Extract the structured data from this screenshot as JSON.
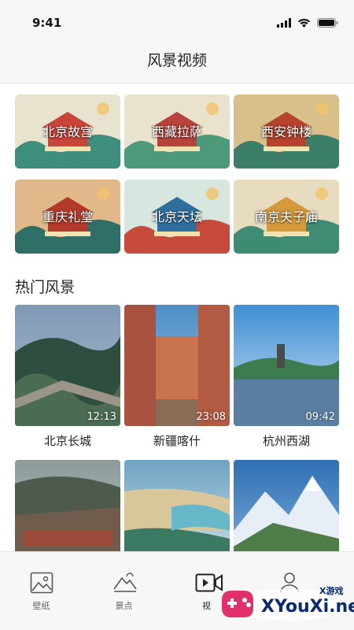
{
  "status_bar": {
    "time": "9:41",
    "icons": [
      "signal-icon",
      "wifi-icon",
      "battery-icon"
    ]
  },
  "nav": {
    "title": "风景视频"
  },
  "categories": [
    {
      "label": "北京故宫",
      "palette": [
        "#e8e3cf",
        "#c9453a",
        "#3e8e7e"
      ]
    },
    {
      "label": "西藏拉萨",
      "palette": [
        "#e9e2cc",
        "#b8423c",
        "#4d9a7a"
      ]
    },
    {
      "label": "西安钟楼",
      "palette": [
        "#d9c08a",
        "#b5432e",
        "#3c7f69"
      ]
    },
    {
      "label": "重庆礼堂",
      "palette": [
        "#e1b88a",
        "#b43a2c",
        "#2f6f67"
      ]
    },
    {
      "label": "北京天坛",
      "palette": [
        "#d7e6df",
        "#2f6f9e",
        "#c64b3a"
      ]
    },
    {
      "label": "南京夫子庙",
      "palette": [
        "#e7dcc0",
        "#d59a3c",
        "#3f8b73"
      ]
    }
  ],
  "hot_section": {
    "title": "热门风景"
  },
  "videos": [
    {
      "name": "北京长城",
      "duration": "12:13",
      "scene": "wall"
    },
    {
      "name": "新疆喀什",
      "duration": "23:08",
      "scene": "street"
    },
    {
      "name": "杭州西湖",
      "duration": "09:42",
      "scene": "lake"
    },
    {
      "name": "",
      "duration": "",
      "scene": "village"
    },
    {
      "name": "",
      "duration": "",
      "scene": "coast"
    },
    {
      "name": "",
      "duration": "",
      "scene": "mountain"
    }
  ],
  "tabs": [
    {
      "label": "壁纸",
      "icon": "image-icon",
      "active": false
    },
    {
      "label": "景点",
      "icon": "landscape-icon",
      "active": false
    },
    {
      "label": "视",
      "icon": "video-icon",
      "active": true
    },
    {
      "label": "",
      "icon": "user-icon",
      "active": false
    }
  ],
  "watermark": {
    "site": "XYouXi.net",
    "text": "X游戏",
    "color": "#e2306c"
  }
}
